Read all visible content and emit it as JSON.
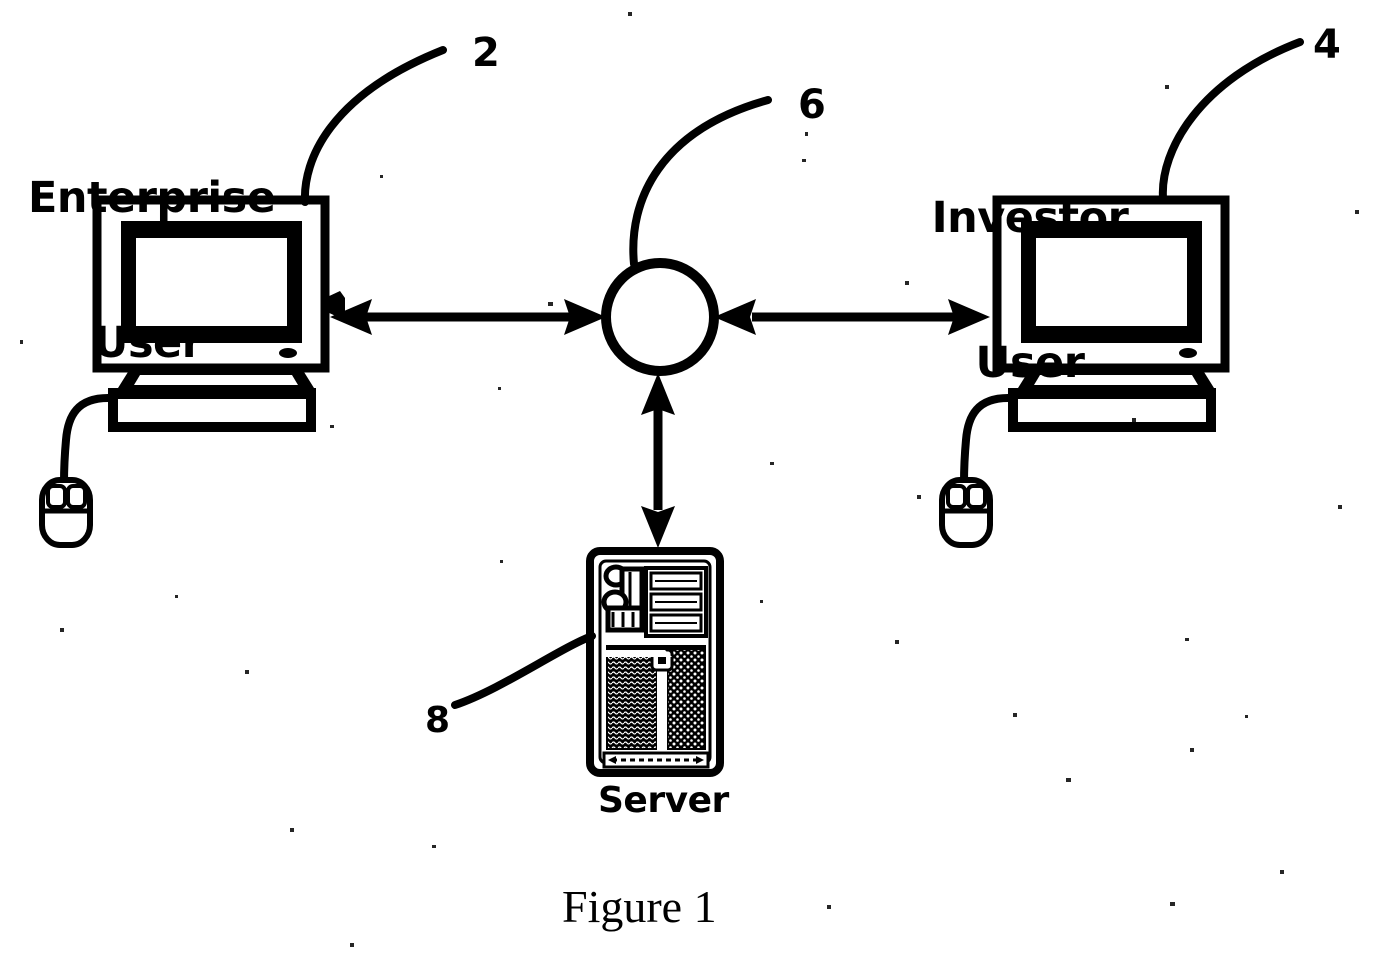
{
  "figure": {
    "caption": "Figure 1",
    "background_color": "#ffffff",
    "ink_color": "#000000"
  },
  "nodes": [
    {
      "id": "enterprise-user",
      "label_line1": "Enterprise",
      "label_line2": "User",
      "callout": "2",
      "icon": "desktop-computer-icon"
    },
    {
      "id": "investor-user",
      "label_line1": "Investor",
      "label_line2": "User",
      "callout": "4",
      "icon": "desktop-computer-icon"
    },
    {
      "id": "network-node",
      "label_line1": "",
      "label_line2": "",
      "callout": "6",
      "icon": "network-circle-icon"
    },
    {
      "id": "server",
      "label_line1": "Server",
      "label_line2": "",
      "callout": "8",
      "icon": "server-tower-icon"
    }
  ],
  "connections": [
    {
      "id": "enterprise-to-network",
      "from": "enterprise-user",
      "to": "network-node",
      "style": "double-arrow",
      "orientation": "horizontal"
    },
    {
      "id": "network-to-investor",
      "from": "network-node",
      "to": "investor-user",
      "style": "double-arrow",
      "orientation": "horizontal"
    },
    {
      "id": "network-to-server",
      "from": "network-node",
      "to": "server",
      "style": "double-arrow",
      "orientation": "vertical"
    }
  ],
  "callouts": {
    "enterprise": "2",
    "investor": "4",
    "network": "6",
    "server": "8"
  },
  "labels": {
    "enterprise_line1": "Enterprise",
    "enterprise_line2": "User",
    "investor_line1": "Investor",
    "investor_line2": "User",
    "server_caption": "Server",
    "figure_caption": "Figure 1"
  }
}
